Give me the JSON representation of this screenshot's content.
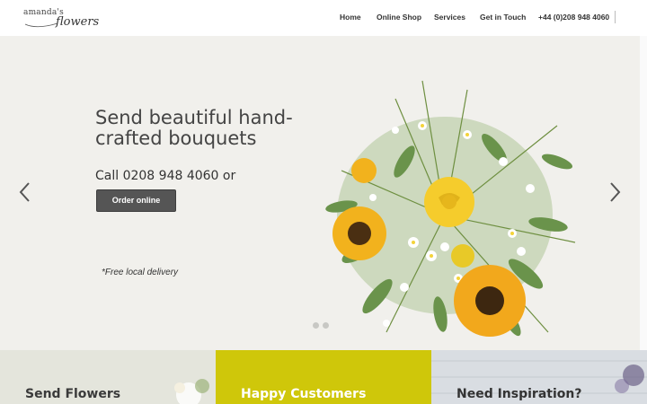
{
  "brand": {
    "logo_top": "amanda's",
    "logo_bottom": "flowers"
  },
  "nav": {
    "items": [
      {
        "label": "Home"
      },
      {
        "label": "Online Shop"
      },
      {
        "label": "Services"
      },
      {
        "label": "Get in Touch"
      },
      {
        "label": "+44 (0)208 948 4060"
      }
    ]
  },
  "hero": {
    "title": "Send beautiful hand-crafted bouquets",
    "call_text": "Call 0208 948 4060 or",
    "order_button": "Order online",
    "delivery_note": "*Free local delivery",
    "slides": 2,
    "active_slide": 1
  },
  "panels": [
    {
      "title": "Send Flowers"
    },
    {
      "title": "Happy Customers"
    },
    {
      "title": "Need Inspiration?"
    }
  ],
  "colors": {
    "hero_bg": "#f1f0ec",
    "panel_green": "#cfc70a",
    "button": "#555555"
  }
}
